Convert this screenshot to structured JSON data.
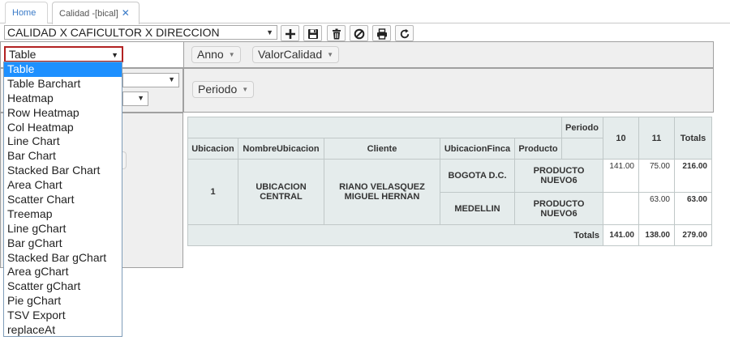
{
  "tabs": {
    "home": "Home",
    "active": "Calidad -[bical]",
    "close": "✕"
  },
  "toolbar": {
    "report_selected": "CALIDAD X CAFICULTOR X DIRECCION",
    "buttons": [
      "add-icon",
      "save-icon",
      "delete-icon",
      "cancel-icon",
      "print-icon",
      "refresh-icon"
    ]
  },
  "pivot": {
    "renderer": "Table",
    "col_fields": [
      "Anno",
      "ValorCalidad"
    ],
    "row_fields": [
      "Periodo"
    ],
    "renderer_options": [
      "Table",
      "Table Barchart",
      "Heatmap",
      "Row Heatmap",
      "Col Heatmap",
      "Line Chart",
      "Bar Chart",
      "Stacked Bar Chart",
      "Area Chart",
      "Scatter Chart",
      "Treemap",
      "Line gChart",
      "Bar gChart",
      "Stacked Bar gChart",
      "Area gChart",
      "Scatter gChart",
      "Pie gChart",
      "TSV Export",
      "replaceAt"
    ]
  },
  "table": {
    "col_attr_label": "Periodo",
    "row_headers": [
      "Ubicacion",
      "NombreUbicacion",
      "Cliente",
      "UbicacionFinca",
      "Producto"
    ],
    "col_keys": [
      "10",
      "11"
    ],
    "totals_label": "Totals",
    "group": {
      "ubicacion": "1",
      "nombre": "UBICACION CENTRAL",
      "cliente": "RIANO VELASQUEZ MIGUEL HERNAN"
    },
    "rows": [
      {
        "finca": "BOGOTA D.C.",
        "producto": "PRODUCTO NUEVO6",
        "v10": "141.00",
        "v11": "75.00",
        "total": "216.00"
      },
      {
        "finca": "MEDELLIN",
        "producto": "PRODUCTO NUEVO6",
        "v10": "",
        "v11": "63.00",
        "total": "63.00"
      }
    ],
    "col_totals": {
      "v10": "141.00",
      "v11": "138.00",
      "grand": "279.00"
    }
  }
}
